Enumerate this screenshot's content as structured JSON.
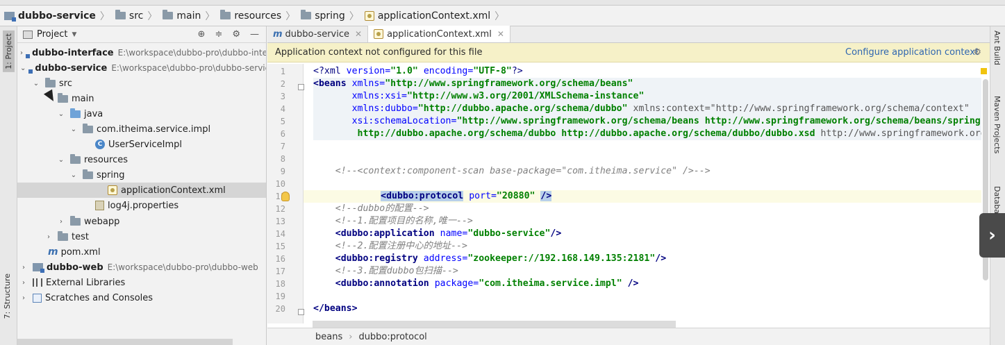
{
  "breadcrumbs": [
    {
      "label": "dubbo-service",
      "icon": "module-icon"
    },
    {
      "label": "src",
      "icon": "folder-icon"
    },
    {
      "label": "main",
      "icon": "folder-icon"
    },
    {
      "label": "resources",
      "icon": "folder-icon"
    },
    {
      "label": "spring",
      "icon": "folder-icon"
    },
    {
      "label": "applicationContext.xml",
      "icon": "xml-file-icon"
    }
  ],
  "left_strip": {
    "project_tab": "1: Project",
    "structure_tab": "7: Structure"
  },
  "project_panel": {
    "title": "Project",
    "tree": [
      {
        "label": "dubbo-interface",
        "path": "E:\\workspace\\dubbo-pro\\dubbo-interface",
        "bold": true
      },
      {
        "label": "dubbo-service",
        "path": "E:\\workspace\\dubbo-pro\\dubbo-service",
        "bold": true
      },
      {
        "label": "src"
      },
      {
        "label": "main"
      },
      {
        "label": "java"
      },
      {
        "label": "com.itheima.service.impl"
      },
      {
        "label": "UserServiceImpl"
      },
      {
        "label": "resources"
      },
      {
        "label": "spring"
      },
      {
        "label": "applicationContext.xml"
      },
      {
        "label": "log4j.properties"
      },
      {
        "label": "webapp"
      },
      {
        "label": "test"
      },
      {
        "label": "pom.xml"
      },
      {
        "label": "dubbo-web",
        "path": "E:\\workspace\\dubbo-pro\\dubbo-web",
        "bold": true
      },
      {
        "label": "External Libraries"
      },
      {
        "label": "Scratches and Consoles"
      }
    ]
  },
  "editor": {
    "tabs": [
      {
        "label": "dubbo-service",
        "active": false
      },
      {
        "label": "applicationContext.xml",
        "active": true
      }
    ],
    "banner": {
      "message": "Application context not configured for this file",
      "action": "Configure application context"
    },
    "status": {
      "path1": "beans",
      "path2": "dubbo:protocol"
    }
  },
  "code_lines": [
    {
      "n": "1"
    },
    {
      "n": "2"
    },
    {
      "n": "3"
    },
    {
      "n": "4"
    },
    {
      "n": "5"
    },
    {
      "n": "6"
    },
    {
      "n": "7"
    },
    {
      "n": "8"
    },
    {
      "n": "9"
    },
    {
      "n": "10"
    },
    {
      "n": "11"
    },
    {
      "n": "12"
    },
    {
      "n": "13"
    },
    {
      "n": "14"
    },
    {
      "n": "15"
    },
    {
      "n": "16"
    },
    {
      "n": "17"
    },
    {
      "n": "18"
    },
    {
      "n": "19"
    },
    {
      "n": "20"
    }
  ],
  "code": {
    "l1_decl": "<?xml ",
    "l1_a1": "version=",
    "l1_v1": "\"1.0\"",
    "l1_a2": " encoding=",
    "l1_v2": "\"UTF-8\"",
    "l1_end": "?>",
    "l2_tag": "<beans ",
    "l2_attr": "xmlns=",
    "l2_val": "\"http://www.springframework.org/schema/beans\"",
    "l3_attr": "xmlns:xsi=",
    "l3_val": "\"http://www.w3.org/2001/XMLSchema-instance\"",
    "l4_attr": "xmlns:dubbo=",
    "l4_val": "\"http://dubbo.apache.org/schema/dubbo\"",
    "l4_rest": " xmlns:context=\"http://www.springframework.org/schema/context\"",
    "l5_attr": "xsi:schemaLocation=",
    "l5_val": "\"http://www.springframework.org/schema/beans http://www.springframework.org/schema/beans/spring-beans.xsd",
    "l6_val": "http://dubbo.apache.org/schema/dubbo http://dubbo.apache.org/schema/dubbo/dubbo.xsd",
    "l6_rest": " http://www.springframework.org/schema/context",
    "l9_comment": "<!--<context:component-scan base-package=\"com.itheima.service\" />-->",
    "l11_tag": "<dubbo:protocol",
    "l11_attr": " port=",
    "l11_val": "\"20880\"",
    "l11_end": "/>",
    "l12_comment": "<!--dubbo的配置-->",
    "l13_comment": "<!--1.配置项目的名称,唯一-->",
    "l14_tag": "<dubbo:application",
    "l14_attr": " name=",
    "l14_val": "\"dubbo-service\"",
    "l14_end": "/>",
    "l15_comment": "<!--2.配置注册中心的地址-->",
    "l16_tag": "<dubbo:registry",
    "l16_attr": " address=",
    "l16_val": "\"zookeeper://192.168.149.135:2181\"",
    "l16_end": "/>",
    "l17_comment": "<!--3.配置dubbo包扫描-->",
    "l18_tag": "<dubbo:annotation",
    "l18_attr": " package=",
    "l18_val": "\"com.itheima.service.impl\"",
    "l18_end": " />",
    "l20_tag": "</beans>"
  },
  "right_strip": {
    "ant": "Ant Build",
    "maven": "Maven Projects",
    "database": "Database"
  }
}
